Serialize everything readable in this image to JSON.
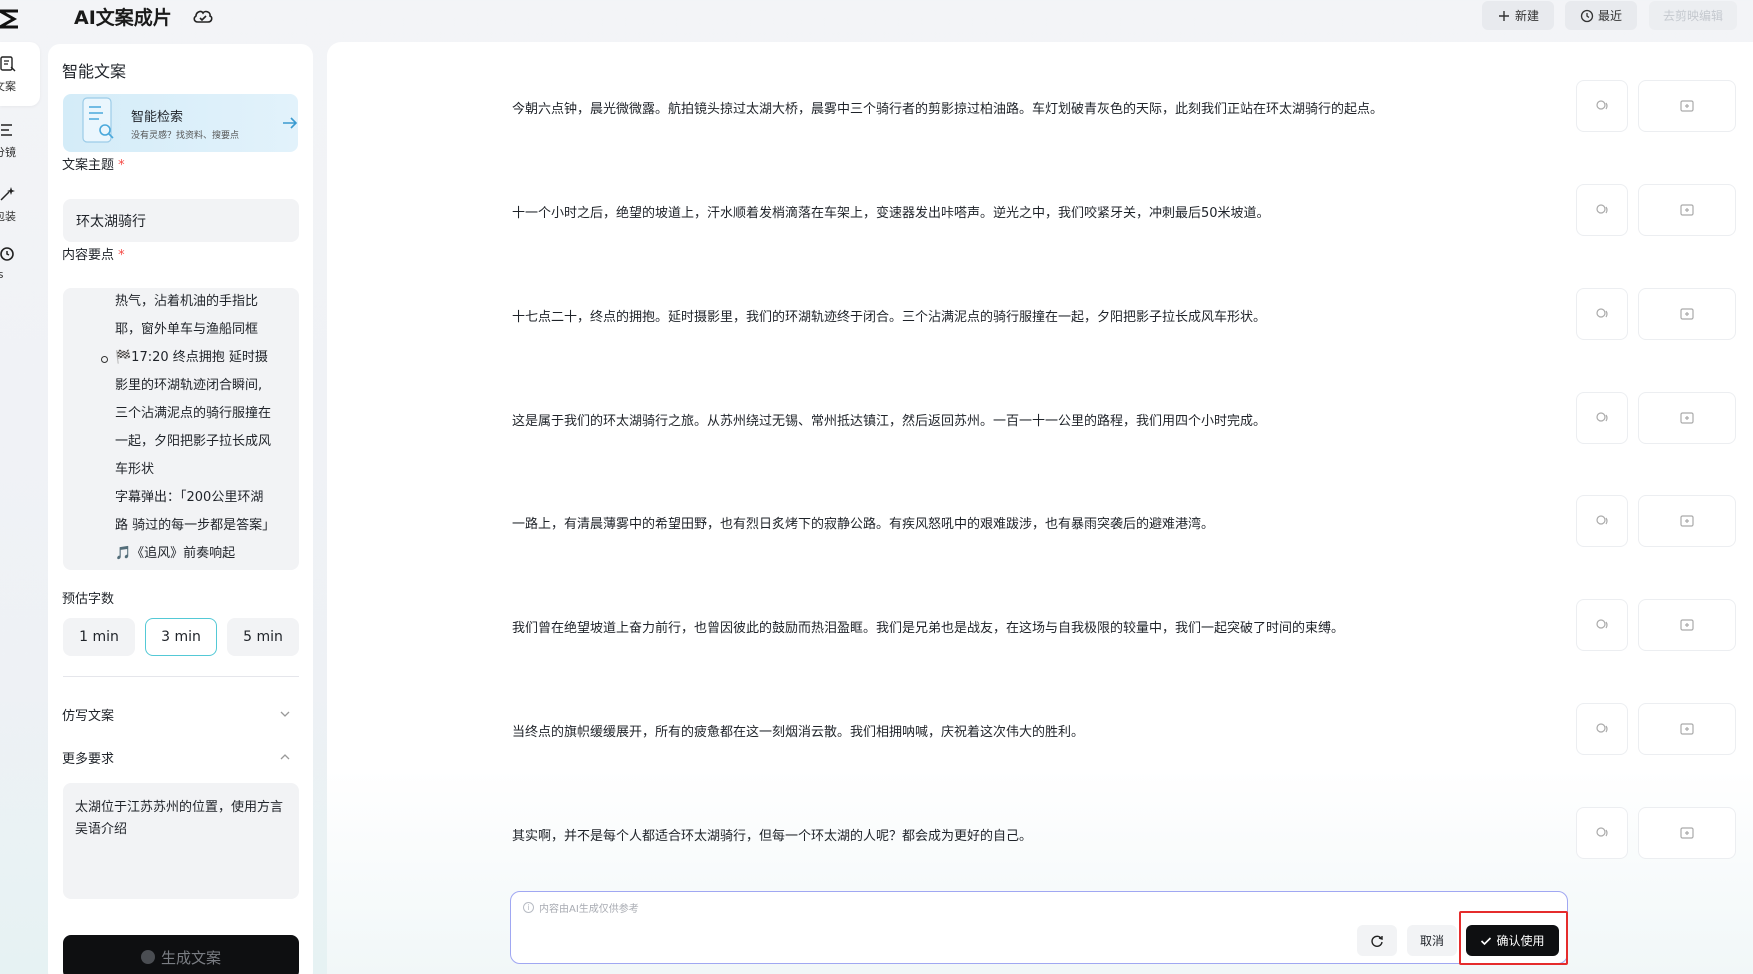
{
  "app": {
    "title": "AI文案成片"
  },
  "topbar": {
    "new_label": "新建",
    "recent_label": "最近",
    "edit_label": "去剪映编辑"
  },
  "rail": [
    {
      "label": "文案",
      "icon": "doc-edit-icon"
    },
    {
      "label": "分镜",
      "icon": "storyboard-icon"
    },
    {
      "label": "包装",
      "icon": "sparkle-icon"
    },
    {
      "label": "/s",
      "icon": "timer-icon"
    }
  ],
  "panel": {
    "title": "智能文案",
    "smart_search": {
      "title": "智能检索",
      "subtitle": "没有灵感？找资料、搜要点"
    },
    "topic": {
      "label": "文案主题",
      "required_mark": "*",
      "value": "环太湖骑行"
    },
    "keypoints": {
      "label": "内容要点",
      "required_mark": "*",
      "lines": [
        "热气，沾着机油的手指比",
        "耶，窗外单车与渔船同框",
        "🏁17:20 终点拥抱 延时摄",
        "影里的环湖轨迹闭合瞬间,",
        "三个沾满泥点的骑行服撞在",
        "一起，夕阳把影子拉长成风",
        "车形状",
        "字幕弹出：「200公里环湖",
        "路 骑过的每一步都是答案」",
        "🎵《追风》前奏响起"
      ]
    },
    "duration": {
      "label": "预估字数",
      "options": [
        "1 min",
        "3 min",
        "5 min"
      ],
      "selected": "3 min"
    },
    "imitate": {
      "label": "仿写文案"
    },
    "more": {
      "label": "更多要求",
      "value": "太湖位于江苏苏州的位置，使用方言吴语介绍"
    },
    "generate_label": "生成文案"
  },
  "paragraphs": [
    "今朝六点钟，晨光微微露。航拍镜头掠过太湖大桥，晨雾中三个骑行者的剪影掠过柏油路。车灯划破青灰色的天际，此刻我们正站在环太湖骑行的起点。",
    "十一个小时之后，绝望的坡道上，汗水顺着发梢滴落在车架上，变速器发出咔嗒声。逆光之中，我们咬紧牙关，冲刺最后50米坡道。",
    "十七点二十，终点的拥抱。延时摄影里，我们的环湖轨迹终于闭合。三个沾满泥点的骑行服撞在一起，夕阳把影子拉长成风车形状。",
    "这是属于我们的环太湖骑行之旅。从苏州绕过无锡、常州抵达镇江，然后返回苏州。一百一十一公里的路程，我们用四个小时完成。",
    "一路上，有清晨薄雾中的希望田野，也有烈日炙烤下的寂静公路。有疾风怒吼中的艰难跋涉，也有暴雨突袭后的避难港湾。",
    "我们曾在绝望坡道上奋力前行，也曾因彼此的鼓励而热泪盈眶。我们是兄弟也是战友，在这场与自我极限的较量中，我们一起突破了时间的束缚。",
    "当终点的旗帜缓缓展开，所有的疲惫都在这一刻烟消云散。我们相拥呐喊，庆祝着这次伟大的胜利。",
    "其实啊，并不是每个人都适合环太湖骑行，但每一个环太湖的人呢？都会成为更好的自己。"
  ],
  "input": {
    "hint": "内容由AI生成仅供参考",
    "cancel_label": "取消",
    "confirm_label": "确认使用"
  },
  "colors": {
    "accent": "#54c9d6",
    "primary_button": "#0e0f11",
    "highlight": "#e52c2c",
    "input_border": "#a0a7f2"
  }
}
